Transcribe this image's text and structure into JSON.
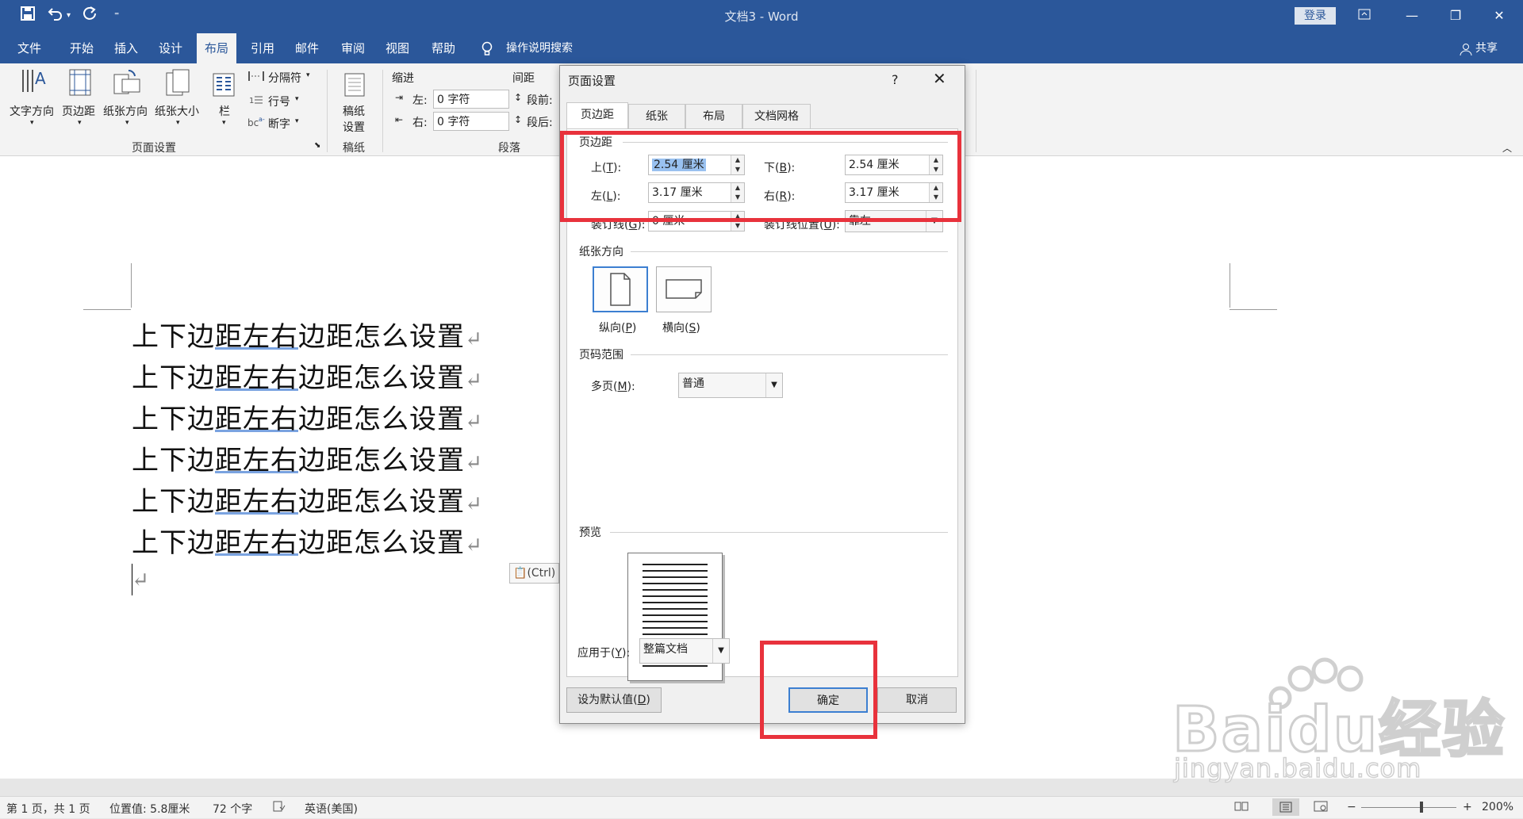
{
  "titlebar": {
    "doc_title": "文档3 - Word",
    "login": "登录",
    "quick_access": [
      "save-icon",
      "undo-icon",
      "redo-icon",
      "customize-icon"
    ]
  },
  "ribbon_tabs": [
    "文件",
    "开始",
    "插入",
    "设计",
    "布局",
    "引用",
    "邮件",
    "审阅",
    "视图",
    "帮助"
  ],
  "active_tab": "布局",
  "tell_me": "操作说明搜索",
  "share": "共享",
  "ribbon": {
    "page_setup": {
      "text_direction": "文字方向",
      "margins": "页边距",
      "orientation": "纸张方向",
      "size": "纸张大小",
      "columns": "栏",
      "breaks": "分隔符",
      "line_numbers": "行号",
      "hyphenation": "断字",
      "group_label": "页面设置"
    },
    "manuscript": {
      "button": "稿纸\n设置",
      "btn_line1": "稿纸",
      "btn_line2": "设置",
      "group_label": "稿纸"
    },
    "paragraph": {
      "indent_label": "缩进",
      "spacing_label": "间距",
      "left_label": "左:",
      "right_label": "右:",
      "left_value": "0 字符",
      "right_value": "0 字符",
      "before_label": "段前:",
      "after_label": "段后:",
      "group_label": "段落"
    }
  },
  "document": {
    "lines": [
      {
        "a": "上下边",
        "b": "距左右",
        "c": "边距怎么设置"
      },
      {
        "a": "上下边",
        "b": "距左右",
        "c": "边距怎么设置"
      },
      {
        "a": "上下边",
        "b": "距左右",
        "c": "边距怎么设置"
      },
      {
        "a": "上下边",
        "b": "距左右",
        "c": "边距怎么设置"
      },
      {
        "a": "上下边",
        "b": "距左右",
        "c": "边距怎么设置"
      },
      {
        "a": "上下边",
        "b": "距左右",
        "c": "边距怎么设置"
      }
    ],
    "paste_options": "(Ctrl)",
    "paragraph_mark": "↵"
  },
  "status": {
    "page": "第 1 页，共 1 页",
    "position": "位置值: 5.8厘米",
    "words": "72 个字",
    "language": "英语(美国)",
    "zoom": "200%"
  },
  "dialog": {
    "title": "页面设置",
    "help": "?",
    "close": "✕",
    "tabs": [
      "页边距",
      "纸张",
      "布局",
      "文档网格"
    ],
    "active_tab": "页边距",
    "margins_section": "页边距",
    "top_label": "上(T):",
    "top_label_a": "上(",
    "top_label_k": "T",
    "top_label_b": "):",
    "top_value": "2.54 厘米",
    "bottom_label_a": "下(",
    "bottom_label_k": "B",
    "bottom_label_b": "):",
    "bottom_value": "2.54 厘米",
    "left_label_a": "左(",
    "left_label_k": "L",
    "left_label_b": "):",
    "left_value": "3.17 厘米",
    "right_label_a": "右(",
    "right_label_k": "R",
    "right_label_b": "):",
    "right_value": "3.17 厘米",
    "gutter_label_a": "装订线(",
    "gutter_label_k": "G",
    "gutter_label_b": "):",
    "gutter_value": "0 厘米",
    "gutter_pos_label_a": "装订线位置(",
    "gutter_pos_label_k": "U",
    "gutter_pos_label_b": "):",
    "gutter_pos_value": "靠左",
    "orientation_section": "纸张方向",
    "portrait_a": "纵向(",
    "portrait_k": "P",
    "portrait_b": ")",
    "landscape_a": "横向(",
    "landscape_k": "S",
    "landscape_b": ")",
    "pages_section": "页码范围",
    "multi_label_a": "多页(",
    "multi_label_k": "M",
    "multi_label_b": "):",
    "multi_value": "普通",
    "preview_section": "预览",
    "apply_label_a": "应用于(",
    "apply_label_k": "Y",
    "apply_label_b": "):",
    "apply_value": "整篇文档",
    "default_btn_a": "设为默认值(",
    "default_btn_k": "D",
    "default_btn_b": ")",
    "ok": "确定",
    "cancel": "取消"
  },
  "watermark": {
    "brand": "Baidu经验",
    "url": "jingyan.baidu.com"
  },
  "colors": {
    "accent": "#2b579a",
    "highlight": "#e8323c",
    "selection": "#99c1f0"
  }
}
